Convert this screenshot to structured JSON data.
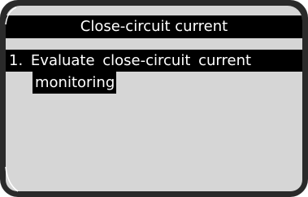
{
  "window": {
    "title": "Close-circuit current"
  },
  "menu": {
    "items": [
      {
        "number": "1.",
        "label_line1": "Evaluate close-circuit current",
        "label_line2": "monitoring",
        "selected": true
      }
    ]
  },
  "colors": {
    "bezel": "#2a2a2a",
    "screen_background": "#d6d6d6",
    "highlight_background": "#000000",
    "highlight_text": "#ffffff"
  }
}
